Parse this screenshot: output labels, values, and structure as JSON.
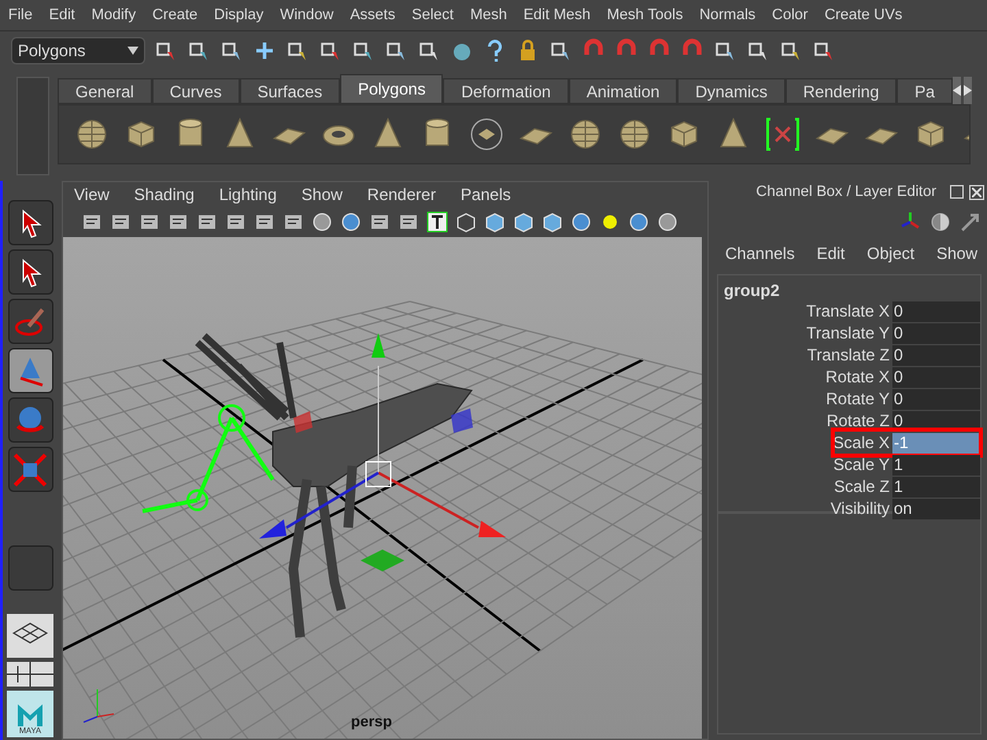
{
  "menu_bar": [
    "File",
    "Edit",
    "Modify",
    "Create",
    "Display",
    "Window",
    "Assets",
    "Select",
    "Mesh",
    "Edit Mesh",
    "Mesh Tools",
    "Normals",
    "Color",
    "Create UVs"
  ],
  "status_line": {
    "menu_set": "Polygons"
  },
  "shelf": {
    "tabs": [
      {
        "label": "General",
        "selected": false
      },
      {
        "label": "Curves",
        "selected": false
      },
      {
        "label": "Surfaces",
        "selected": false
      },
      {
        "label": "Polygons",
        "selected": true
      },
      {
        "label": "Deformation",
        "selected": false
      },
      {
        "label": "Animation",
        "selected": false
      },
      {
        "label": "Dynamics",
        "selected": false
      },
      {
        "label": "Rendering",
        "selected": false
      },
      {
        "label": "Pa",
        "selected": false
      }
    ]
  },
  "toolbox": {
    "logo_text": "MAYA"
  },
  "viewport": {
    "menus": [
      "View",
      "Shading",
      "Lighting",
      "Show",
      "Renderer",
      "Panels"
    ],
    "camera_label": "persp"
  },
  "channel_box": {
    "title": "Channel Box / Layer Editor",
    "menus": [
      "Channels",
      "Edit",
      "Object",
      "Show"
    ],
    "object_name": "group2",
    "channels": [
      {
        "name": "Translate X",
        "value": "0",
        "selected": false,
        "outlined": false
      },
      {
        "name": "Translate Y",
        "value": "0",
        "selected": false,
        "outlined": false
      },
      {
        "name": "Translate Z",
        "value": "0",
        "selected": false,
        "outlined": false
      },
      {
        "name": "Rotate X",
        "value": "0",
        "selected": false,
        "outlined": false
      },
      {
        "name": "Rotate Y",
        "value": "0",
        "selected": false,
        "outlined": false
      },
      {
        "name": "Rotate Z",
        "value": "0",
        "selected": false,
        "outlined": false
      },
      {
        "name": "Scale X",
        "value": "-1",
        "selected": true,
        "outlined": true
      },
      {
        "name": "Scale Y",
        "value": "1",
        "selected": false,
        "outlined": false
      },
      {
        "name": "Scale Z",
        "value": "1",
        "selected": false,
        "outlined": false
      },
      {
        "name": "Visibility",
        "value": "on",
        "selected": false,
        "outlined": false
      }
    ]
  }
}
